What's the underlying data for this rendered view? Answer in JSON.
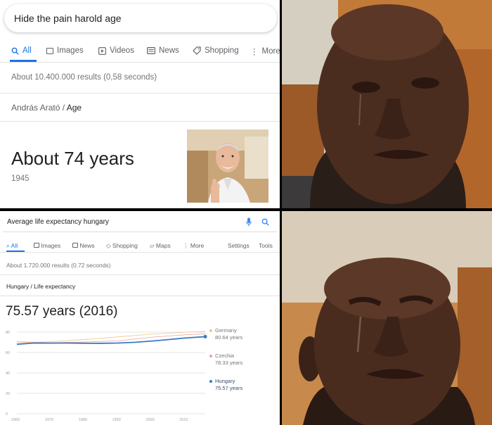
{
  "panel1": {
    "query": "Hide the pain harold age",
    "tabs": [
      "All",
      "Images",
      "Videos",
      "News",
      "Shopping",
      "More"
    ],
    "results_stats": "About 10.400.000 results (0,58 seconds)",
    "breadcrumb_subject": "András Arató",
    "breadcrumb_sep": "/",
    "breadcrumb_attr": "Age",
    "answer": "About 74 years",
    "birth_year": "1945"
  },
  "panel3": {
    "query": "Average life expectancy hungary",
    "tabs": [
      "All",
      "Images",
      "News",
      "Shopping",
      "Maps",
      "More"
    ],
    "settings": "Settings",
    "tools": "Tools",
    "results_stats": "About 1.720.000 results (0.72 seconds)",
    "breadcrumb": "Hungary / Life expectancy",
    "answer": "75.57 years (2016)"
  },
  "colors": {
    "accent": "#1a73e8",
    "germany": "#f0c48a",
    "czechia": "#e8a2a2",
    "hungary": "#3b79c2"
  },
  "chart_data": {
    "type": "line",
    "x_ticks": [
      "1960",
      "1970",
      "1980",
      "1990",
      "2000",
      "2010"
    ],
    "y_ticks": [
      "0",
      "20",
      "40",
      "60",
      "80"
    ],
    "xlim": [
      1960,
      2016
    ],
    "ylim": [
      0,
      80
    ],
    "series": [
      {
        "name": "Germany",
        "label": "80.64 years",
        "x": [
          1960,
          1970,
          1980,
          1990,
          2000,
          2010,
          2016
        ],
        "values": [
          69.3,
          70.6,
          72.7,
          75.3,
          78.0,
          79.9,
          80.64
        ]
      },
      {
        "name": "Czechia",
        "label": "78.33 years",
        "x": [
          1960,
          1970,
          1980,
          1990,
          2000,
          2010,
          2016
        ],
        "values": [
          70.6,
          69.6,
          70.3,
          71.4,
          75.0,
          77.4,
          78.33
        ]
      },
      {
        "name": "Hungary",
        "label": "75.57 years",
        "x": [
          1960,
          1965,
          1970,
          1975,
          1980,
          1985,
          1990,
          1995,
          2000,
          2005,
          2010,
          2016
        ],
        "values": [
          68.0,
          69.3,
          69.2,
          69.3,
          69.1,
          69.0,
          69.3,
          70.0,
          71.2,
          72.7,
          74.2,
          75.57
        ]
      }
    ]
  }
}
